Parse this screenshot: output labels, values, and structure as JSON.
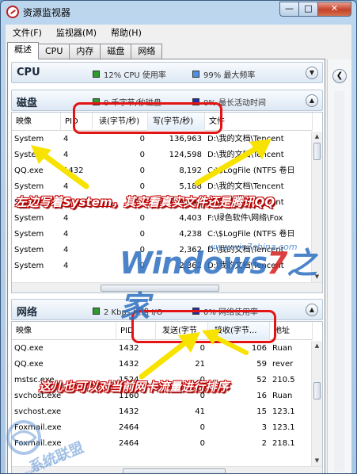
{
  "window": {
    "title": "资源监视器",
    "controls": {
      "minimize": "—",
      "maximize": "□",
      "close": "✕"
    }
  },
  "menu": [
    "文件(F)",
    "监视器(M)",
    "帮助(H)"
  ],
  "tabs": [
    "概述",
    "CPU",
    "内存",
    "磁盘",
    "网络"
  ],
  "cpu_section": {
    "title": "CPU",
    "stat1": "12% CPU 使用率",
    "stat1_color": "#2e9b2e",
    "stat2": "99% 最大频率",
    "stat2_color": "#4f8fe0"
  },
  "disk_section": {
    "title": "磁盘",
    "stat1": "0 千字节/秒磁盘",
    "stat1_color": "#2e9b2e",
    "stat2": "0% 最长活动时间",
    "stat2_color": "#1c2fa8",
    "columns": [
      "映像",
      "PID",
      "读(字节/秒)",
      "写(字节/秒)",
      "文件"
    ],
    "rows": [
      [
        "System",
        "4",
        "0",
        "136,963",
        "D:\\我的文档\\Tencent"
      ],
      [
        "System",
        "4",
        "0",
        "124,598",
        "D:\\我的文档\\Tencent"
      ],
      [
        "QQ.exe",
        "1432",
        "0",
        "8,192",
        "C:\\$LogFile (NTFS 卷日"
      ],
      [
        "System",
        "4",
        "0",
        "5,188",
        "D:\\我的文档\\Tencent"
      ],
      [
        "System",
        "4",
        "0",
        "4,949",
        "D:\\我的文档\\Tencent"
      ],
      [
        "System",
        "4",
        "0",
        "4,403",
        "F:\\绿色软件\\网络\\Fox"
      ],
      [
        "System",
        "4",
        "0",
        "4,238",
        "C:\\$LogFile (NTFS 卷日"
      ],
      [
        "System",
        "4",
        "0",
        "2,362",
        "D:\\我的文档\\Tencent"
      ],
      [
        "System",
        "4",
        "0",
        "2,362",
        "D:\\我的文档\\Tencent"
      ]
    ]
  },
  "network_section": {
    "title": "网络",
    "stat1": "2 Kbps 网络 I/O",
    "stat1_color": "#2e9b2e",
    "stat2": "0% 网络使用率",
    "stat2_color": "#1c2fa8",
    "columns": [
      "映像",
      "PID",
      "发送(字节",
      "接收(字节...",
      "地址"
    ],
    "rows": [
      [
        "QQ.exe",
        "1432",
        "0",
        "106",
        "Ruan"
      ],
      [
        "QQ.exe",
        "1432",
        "21",
        "59",
        "rever"
      ],
      [
        "mstsc.exe",
        "1524",
        "0",
        "52",
        "210.5"
      ],
      [
        "svchost.exe",
        "1160",
        "0",
        "16",
        "Ruan"
      ],
      [
        "svchost.exe",
        "1432",
        "41",
        "15",
        "123.1"
      ],
      [
        "Foxmail.exe",
        "2464",
        "0",
        "3",
        "123.1"
      ],
      [
        "Foxmail.exe",
        "2464",
        "0",
        "2",
        "218.1"
      ]
    ]
  },
  "annotations": {
    "disk_note": "左边写着System，其实看真实文件还是腾讯QQ",
    "network_note": "这儿也可以对当前网卡流量进行排序"
  },
  "branding": {
    "logo_main": "Windows7之家",
    "logo_windows": "Windows",
    "logo_seven": "7",
    "logo_home": "之家",
    "logo_url": "www.win7china.com",
    "watermark": "系统联盟",
    "watermark_url": "www.lyxt.com"
  }
}
